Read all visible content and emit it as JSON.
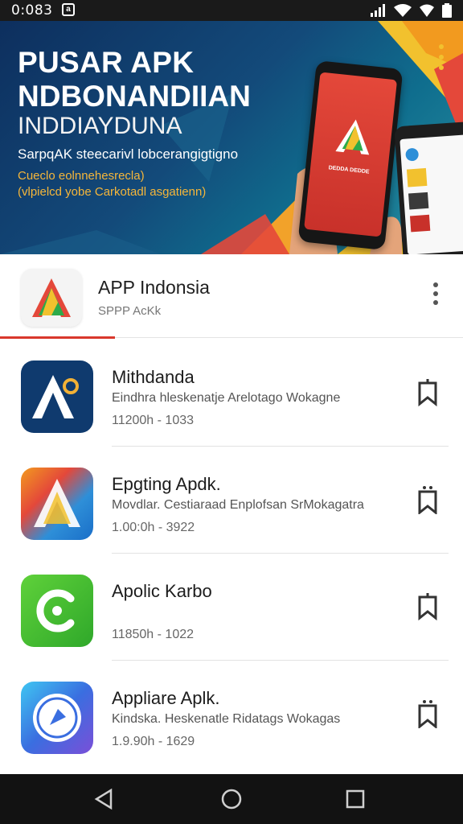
{
  "status_bar": {
    "time": "0:083",
    "notification": "a"
  },
  "banner": {
    "title_line1": "PUSAR APK",
    "title_line2": "NDBONANDIIAN",
    "subtitle": "INDDIAYDUNA",
    "tagline": "SarpqAK steecarivl lobcerangigtigno",
    "note_line1": "Cueclo eolnnehesrecla)",
    "note_line2": "(vlpielcd yobe Carkotadl asgatienn)",
    "phone_label": "DEDDA DEDDE",
    "colors": {
      "accent_red": "#e4483a",
      "accent_orange": "#f29a1f",
      "accent_yellow": "#f2c12e"
    }
  },
  "app_header": {
    "title": "APP Indonsia",
    "subtitle": "SPPP AcKk"
  },
  "apps": [
    {
      "title": "Mithdanda",
      "description": "Eindhra hleskenatje Arelotago Wokagne",
      "meta": "11200h - 1033",
      "icon": "navy-a-logo-icon"
    },
    {
      "title": "Epgting Apdk.",
      "description": "Movdlar. Cestiaraad Enplofsan SrMokagatra",
      "meta": "1.00:0h - 3922",
      "icon": "gradient-a-logo-icon"
    },
    {
      "title": "Apolic Karbo",
      "description": "",
      "meta": "11850h - 1022",
      "icon": "green-c-logo-icon"
    },
    {
      "title": "Appliare Aplk.",
      "description": "Kindska. Heskenatle Ridatags Wokagas",
      "meta": "1.9.90h - 1629",
      "icon": "compass-logo-icon"
    }
  ]
}
